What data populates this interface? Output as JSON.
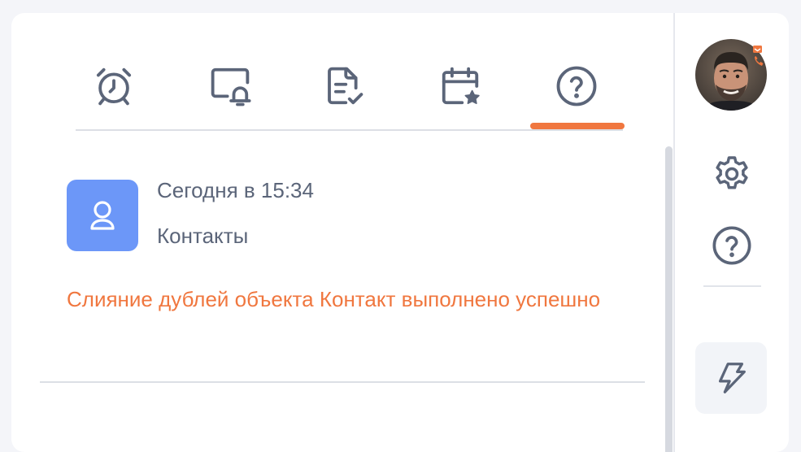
{
  "tabs": [
    {
      "icon": "alarm-clock-icon"
    },
    {
      "icon": "screen-bell-icon"
    },
    {
      "icon": "document-check-icon"
    },
    {
      "icon": "calendar-star-icon"
    },
    {
      "icon": "help-circle-icon",
      "active": true
    }
  ],
  "notification": {
    "time": "Сегодня в 15:34",
    "source": "Контакты",
    "message": "Слияние дублей объекта Контакт выполнено успешно",
    "avatar_icon": "user-icon"
  },
  "rail": {
    "avatar": "user-photo",
    "items": [
      "gear-icon",
      "help-circle-icon",
      "bolt-icon"
    ]
  },
  "colors": {
    "accent": "#f0773f",
    "icon": "#5b6579",
    "avatar_bg": "#6c97f8"
  }
}
